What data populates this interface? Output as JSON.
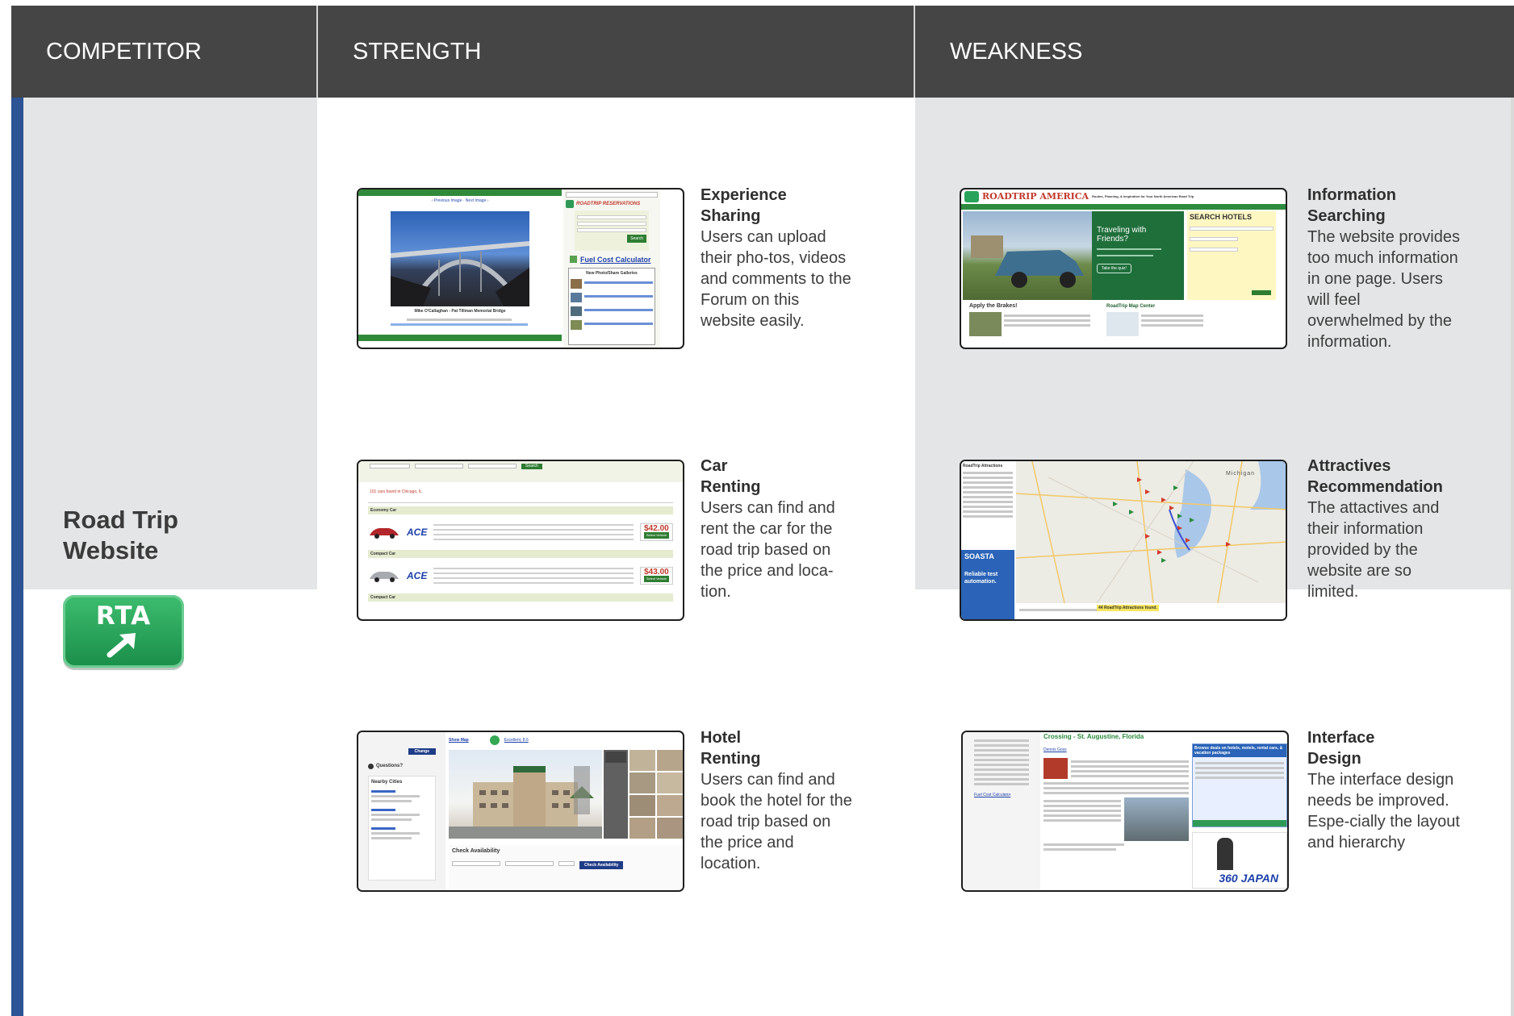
{
  "headers": {
    "competitor": "COMPETITOR",
    "strength": "STRENGTH",
    "weakness": "WEAKNESS"
  },
  "competitor": {
    "name_line1": "Road Trip",
    "name_line2": "Website",
    "logo_text": "RTA"
  },
  "strengths": [
    {
      "title_line1": "Experience",
      "title_line2": "Sharing",
      "body": "Users can upload their pho-tos, videos and comments to the Forum on this website easily."
    },
    {
      "title_line1": "Car",
      "title_line2": "Renting",
      "body": "Users can find and rent the car for the road trip based on the price and loca-tion."
    },
    {
      "title_line1": "Hotel",
      "title_line2": "Renting",
      "body": "Users can find and book the hotel for the road trip based on the price and location."
    }
  ],
  "weaknesses": [
    {
      "title_line1": "Information",
      "title_line2": "Searching",
      "body": "The website provides too much information in one page. Users will feel overwhelmed by the information."
    },
    {
      "title_line1": "Attractives",
      "title_line2": "Recommendation",
      "body": "The attactives and their information provided by the website are so limited."
    },
    {
      "title_line1": "Interface",
      "title_line2": "Design",
      "body": "The interface design  needs be improved. Espe-cially the layout and hierarchy"
    }
  ],
  "screens": {
    "photo_site": {
      "brand": "ROADTRIP RESERVATIONS",
      "fuel_link": "Fuel Cost Calculator",
      "gallery_heading": "New Photo/Share Galleries",
      "caption": "Mike O'Callaghan - Pat Tillman Memorial Bridge",
      "search_button": "Search"
    },
    "car_site": {
      "results": "101 cars found in Chicago, IL",
      "class1": "Economy Car",
      "class2": "Compact Car",
      "class3": "Compact Car",
      "price1": "$42.00",
      "price2": "$43.00",
      "vendor": "ACE",
      "search_button": "Search",
      "select_button": "Select Vehicle"
    },
    "hotel_site": {
      "show_map": "Show Map",
      "rating": "Excellent, 8.6",
      "nearby_heading": "Nearby Cities",
      "availability_heading": "Check Availability",
      "availability_button": "Check Availability",
      "change_button": "Change",
      "questions": "Questions?"
    },
    "rta_home": {
      "brand": "ROADTRIP AMERICA",
      "tagline": "Routes, Planning, & Inspiration for Your North American Road Trip",
      "hero_title": "Traveling with Friends?",
      "hero_button": "Take the quiz!",
      "search_hotels": "SEARCH HOTELS",
      "apply_brakes": "Apply the Brakes!",
      "map_center": "RoadTrip Map Center"
    },
    "map_site": {
      "heading": "RoadTrip Attractions",
      "found": "44 RoadTrip Attractions found.",
      "ad_brand": "SOASTA",
      "ad_text": "Reliable test automation.",
      "lake_label": "Michigan"
    },
    "article_site": {
      "title": "Crossing - St. Augustine, Florida",
      "author": "Dennis Goss",
      "fuel_link": "Fuel Cost Calculator",
      "ad_text": "Browse deals on hotels, motels, rental cars, & vacation packages",
      "japan_ad": "360 JAPAN"
    }
  },
  "colors": {
    "header_bg": "#454545",
    "accent_blue": "#2c5394",
    "panel_gray": "#e4e5e6",
    "rta_green": "#2aa35a",
    "site_green": "#2f8a3a"
  }
}
